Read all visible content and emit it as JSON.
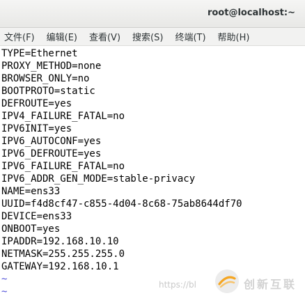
{
  "window": {
    "title": "root@localhost:~"
  },
  "menu": {
    "items": [
      {
        "label": "文件(F)"
      },
      {
        "label": "编辑(E)"
      },
      {
        "label": "查看(V)"
      },
      {
        "label": "搜索(S)"
      },
      {
        "label": "终端(T)"
      },
      {
        "label": "帮助(H)"
      }
    ]
  },
  "terminal": {
    "lines": [
      "TYPE=Ethernet",
      "PROXY_METHOD=none",
      "BROWSER_ONLY=no",
      "BOOTPROTO=static",
      "DEFROUTE=yes",
      "IPV4_FAILURE_FATAL=no",
      "IPV6INIT=yes",
      "IPV6_AUTOCONF=yes",
      "IPV6_DEFROUTE=yes",
      "IPV6_FAILURE_FATAL=no",
      "IPV6_ADDR_GEN_MODE=stable-privacy",
      "NAME=ens33",
      "UUID=f4d8cf47-c855-4d04-8c68-75ab8644df70",
      "DEVICE=ens33",
      "ONBOOT=yes",
      "IPADDR=192.168.10.10",
      "NETMASK=255.255.255.0",
      "GATEWAY=192.168.10.1"
    ],
    "tildes": [
      "~",
      "~"
    ],
    "text_color": "#000000",
    "tilde_color": "#5050d8"
  },
  "watermark": {
    "url": "https://bl",
    "brand": "创新互联",
    "logo_color": "#f5a623"
  }
}
